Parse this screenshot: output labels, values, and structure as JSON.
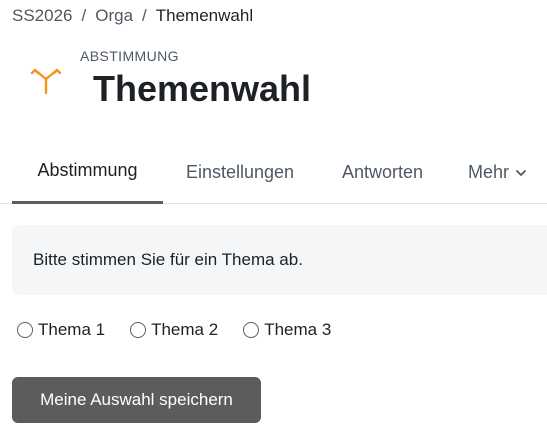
{
  "breadcrumb": {
    "items": [
      "SS2026",
      "Orga",
      "Themenwahl"
    ],
    "separator": "/"
  },
  "header": {
    "icon": "fork-arrows-icon",
    "icon_color": "#f7941d",
    "activity_type": "ABSTIMMUNG",
    "title": "Themenwahl"
  },
  "tabs": [
    {
      "label": "Abstimmung",
      "active": true
    },
    {
      "label": "Einstellungen",
      "active": false
    },
    {
      "label": "Antworten",
      "active": false
    },
    {
      "label": "Mehr",
      "active": false
    }
  ],
  "intro": {
    "text": "Bitte stimmen Sie für ein Thema ab."
  },
  "options": [
    {
      "label": "Thema 1",
      "checked": false
    },
    {
      "label": "Thema 2",
      "checked": false
    },
    {
      "label": "Thema 3",
      "checked": false
    }
  ],
  "save_button": {
    "label": "Meine Auswahl speichern",
    "color": "#5c5c5c"
  }
}
